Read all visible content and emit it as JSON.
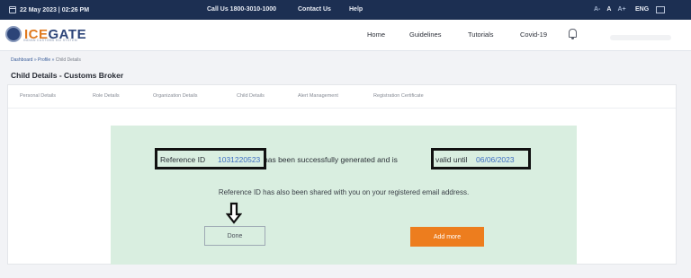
{
  "topbar": {
    "date": "22 May 2023 | 02:26 PM",
    "call": "Call Us  1800-3010-1000",
    "contact": "Contact Us",
    "help": "Help",
    "font_sizes": [
      "A-",
      "A",
      "A+"
    ],
    "language": "ENG"
  },
  "header": {
    "logo_text_a": "ICE",
    "logo_text_b": "GATE",
    "logo_sub": "INDIAN CUSTOMS EDI SYSTEM",
    "nav": [
      "Home",
      "Guidelines",
      "Tutorials",
      "Covid-19"
    ]
  },
  "breadcrumb": {
    "dashboard": "Dashboard",
    "sep1": " » ",
    "profile": "Profile",
    "sep2": " » ",
    "current": "Child Details"
  },
  "page_title": "Child Details - Customs Broker",
  "tabs": [
    "Personal Details",
    "Role Details",
    "Organization Details",
    "Child Details",
    "Alert Management",
    "Registration Certificate"
  ],
  "success": {
    "ref_label": "Reference ID",
    "ref_id": "1031220523",
    "msg_mid": "has been successfully generated and is ",
    "valid_label": "valid until",
    "valid_date": "06/06/2023",
    "shared_msg": "Reference ID has also been shared with you on your registered email address.",
    "done_label": "Done",
    "add_more_label": "Add more"
  },
  "colors": {
    "topbar_bg": "#1c2f52",
    "success_bg": "#d9eee0",
    "link_blue": "#3f6fc4",
    "accent_orange": "#ed7d1e"
  }
}
